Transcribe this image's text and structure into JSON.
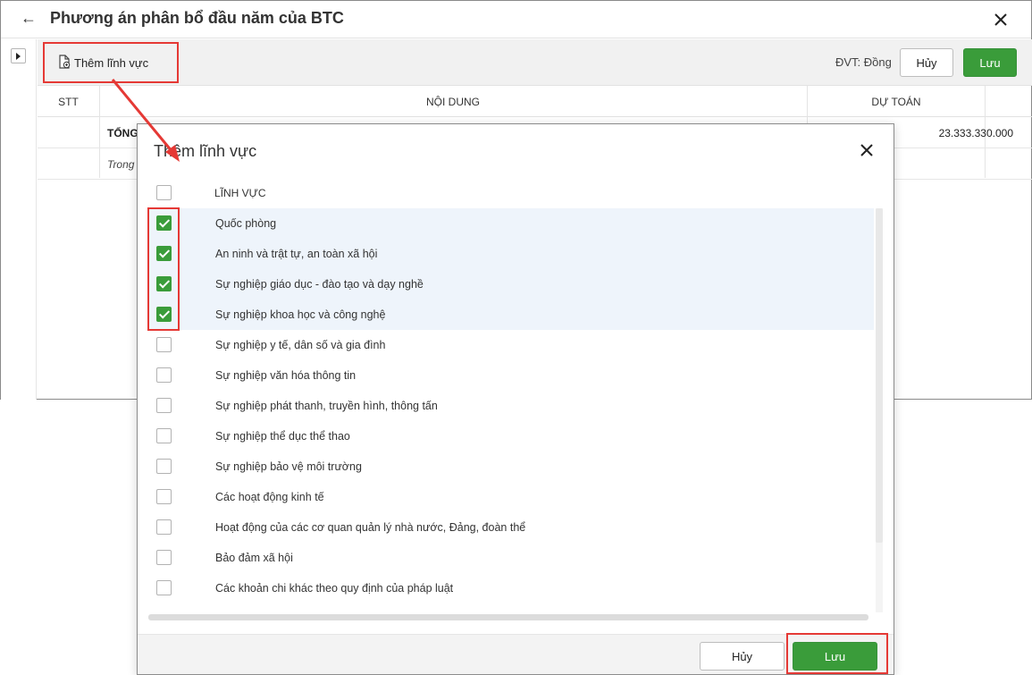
{
  "window": {
    "title": "Phương án phân bổ đầu năm của BTC",
    "back_icon": "arrow-left-icon",
    "close_icon": "close-icon"
  },
  "toolbar": {
    "add_field_label": "Thêm lĩnh vực",
    "add_field_icon": "document-add-icon",
    "unit_label": "ĐVT: Đồng",
    "cancel_label": "Hủy",
    "save_label": "Lưu"
  },
  "grid": {
    "columns": [
      "STT",
      "NỘI DUNG",
      "DỰ TOÁN"
    ],
    "rows": [
      {
        "content": "TỔNG",
        "amount": "23.333.330.000"
      },
      {
        "content": "Trong",
        "amount": ""
      }
    ]
  },
  "modal": {
    "title": "Thêm lĩnh vực",
    "header_label": "LĨNH VỰC",
    "items": [
      {
        "label": "Quốc phòng",
        "checked": true
      },
      {
        "label": "An ninh và trật tự, an toàn xã hội",
        "checked": true
      },
      {
        "label": "Sự nghiệp giáo dục - đào tạo và dạy nghề",
        "checked": true
      },
      {
        "label": "Sự nghiệp khoa học và công nghệ",
        "checked": true
      },
      {
        "label": "Sự nghiệp y tế, dân số và gia đình",
        "checked": false
      },
      {
        "label": "Sự nghiệp văn hóa thông tin",
        "checked": false
      },
      {
        "label": "Sự nghiệp phát thanh, truyền hình, thông tấn",
        "checked": false
      },
      {
        "label": "Sự nghiệp thể dục thể thao",
        "checked": false
      },
      {
        "label": "Sự nghiệp bảo vệ môi trường",
        "checked": false
      },
      {
        "label": "Các hoạt động kinh tế",
        "checked": false
      },
      {
        "label": "Hoạt động của các cơ quan quản lý nhà nước, Đảng, đoàn thể",
        "checked": false
      },
      {
        "label": "Bảo đảm xã hội",
        "checked": false
      },
      {
        "label": "Các khoản chi khác theo quy định của pháp luật",
        "checked": false
      }
    ],
    "cancel_label": "Hủy",
    "save_label": "Lưu"
  },
  "colors": {
    "accent_green": "#3a9c3a",
    "annotation_red": "#e53935",
    "selected_row": "#eef4fb"
  }
}
